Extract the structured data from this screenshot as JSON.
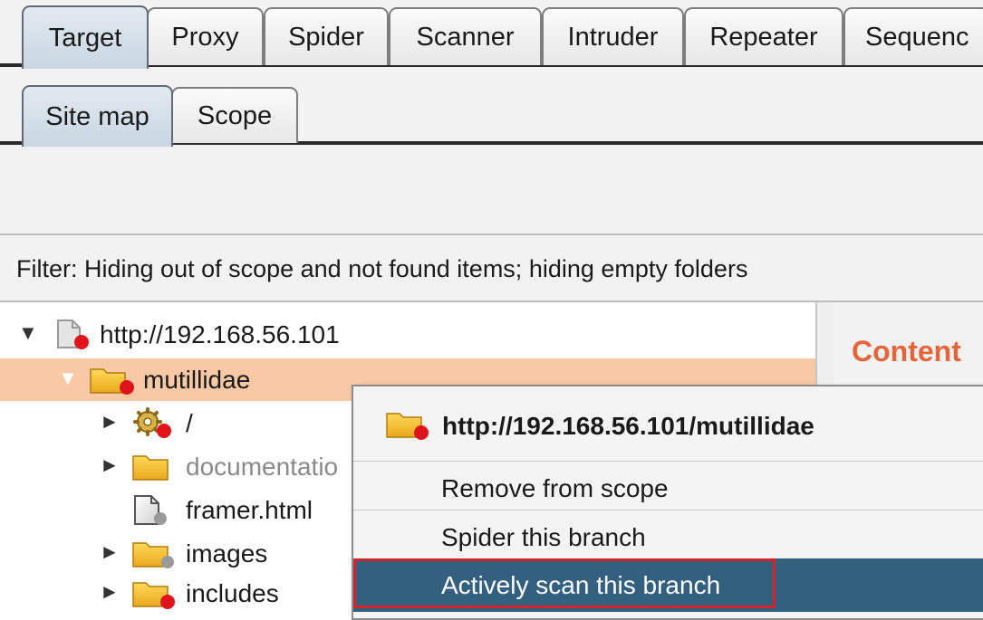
{
  "top_tabs": [
    {
      "label": "Target",
      "active": true
    },
    {
      "label": "Proxy",
      "active": false
    },
    {
      "label": "Spider",
      "active": false
    },
    {
      "label": "Scanner",
      "active": false
    },
    {
      "label": "Intruder",
      "active": false
    },
    {
      "label": "Repeater",
      "active": false
    },
    {
      "label": "Sequenc",
      "active": false
    }
  ],
  "sub_tabs": [
    {
      "label": "Site map",
      "active": true
    },
    {
      "label": "Scope",
      "active": false
    }
  ],
  "filter": {
    "text": "Filter: Hiding out of scope and not found items;  hiding empty folders"
  },
  "tree": {
    "items": [
      {
        "label": "http://192.168.56.101",
        "icon": "page-red-dot-icon",
        "expanded": true,
        "selected": false
      },
      {
        "label": "mutillidae",
        "icon": "folder-red-dot-icon",
        "expanded": true,
        "selected": true
      },
      {
        "label": "/",
        "icon": "gear-red-dot-icon",
        "expanded": false,
        "selected": false
      },
      {
        "label": "documentatio",
        "icon": "folder-icon",
        "expanded": false,
        "selected": false
      },
      {
        "label": "framer.html",
        "icon": "page-grey-dot-icon",
        "expanded": null,
        "selected": false
      },
      {
        "label": "images",
        "icon": "folder-grey-dot-icon",
        "expanded": false,
        "selected": false
      },
      {
        "label": "includes",
        "icon": "folder-red-dot-icon",
        "expanded": false,
        "selected": false
      }
    ]
  },
  "right_panel": {
    "heading": "Content"
  },
  "context_menu": {
    "header": "http://192.168.56.101/mutillidae",
    "items": [
      {
        "label": "Remove from scope",
        "highlighted": false
      },
      {
        "label": "Spider this branch",
        "highlighted": false
      },
      {
        "label": "Actively scan this branch",
        "highlighted": true
      }
    ]
  },
  "colors": {
    "selected_row": "#f9c8a4",
    "menu_highlight": "#33607f",
    "annotation_outline": "#d4232b",
    "heading_accent": "#e8643a",
    "red_dot": "#e1141b"
  }
}
